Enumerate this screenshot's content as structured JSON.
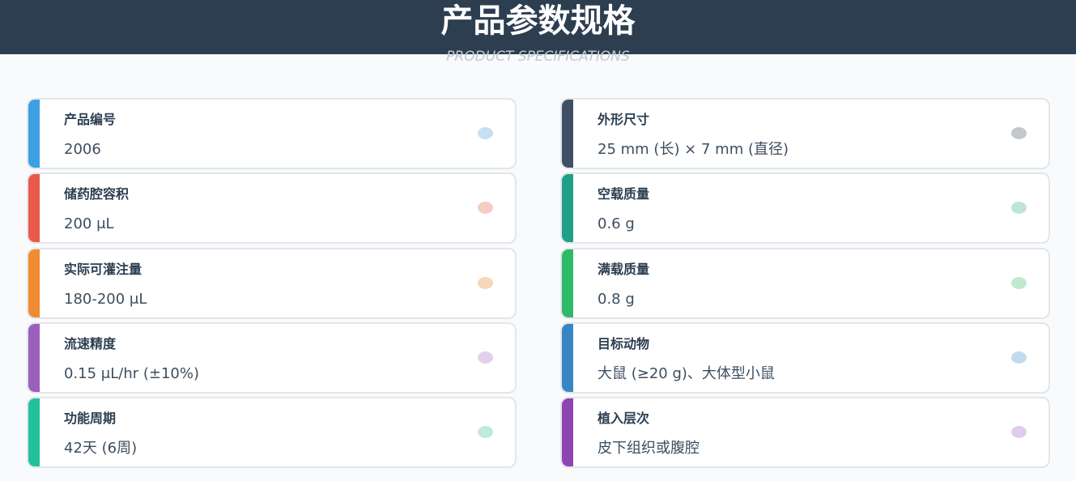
{
  "header": {
    "title": "产品参数规格",
    "subtitle": "PRODUCT SPECIFICATIONS"
  },
  "specs": [
    {
      "label": "产品编号",
      "value": "2006",
      "color": "#3ca1e0",
      "dot_color": "#c5e0f3"
    },
    {
      "label": "外形尺寸",
      "value": "25 mm (长) × 7 mm (直径)",
      "color": "#3f5065",
      "dot_color": "#c3c8cd"
    },
    {
      "label": "储药腔容积",
      "value": "200 μL",
      "color": "#ea5a4a",
      "dot_color": "#f7cbc5"
    },
    {
      "label": "空载质量",
      "value": "0.6 g",
      "color": "#21a087",
      "dot_color": "#bde5dc"
    },
    {
      "label": "实际可灌注量",
      "value": "180-200 μL",
      "color": "#ef8b30",
      "dot_color": "#f8d6b9"
    },
    {
      "label": "满载质量",
      "value": "0.8 g",
      "color": "#2eba67",
      "dot_color": "#c0e9d0"
    },
    {
      "label": "流速精度",
      "value": "0.15 μL/hr (±10%)",
      "color": "#9c5fbd",
      "dot_color": "#e2d0ec"
    },
    {
      "label": "目标动物",
      "value": "大鼠 (≥20 g)、大体型小鼠",
      "color": "#3686c5",
      "dot_color": "#c3dbed"
    },
    {
      "label": "功能周期",
      "value": "42天 (6周)",
      "color": "#22c19c",
      "dot_color": "#bdeae0"
    },
    {
      "label": "植入层次",
      "value": "皮下组织或腹腔",
      "color": "#8e45b0",
      "dot_color": "#e1cdea"
    }
  ]
}
